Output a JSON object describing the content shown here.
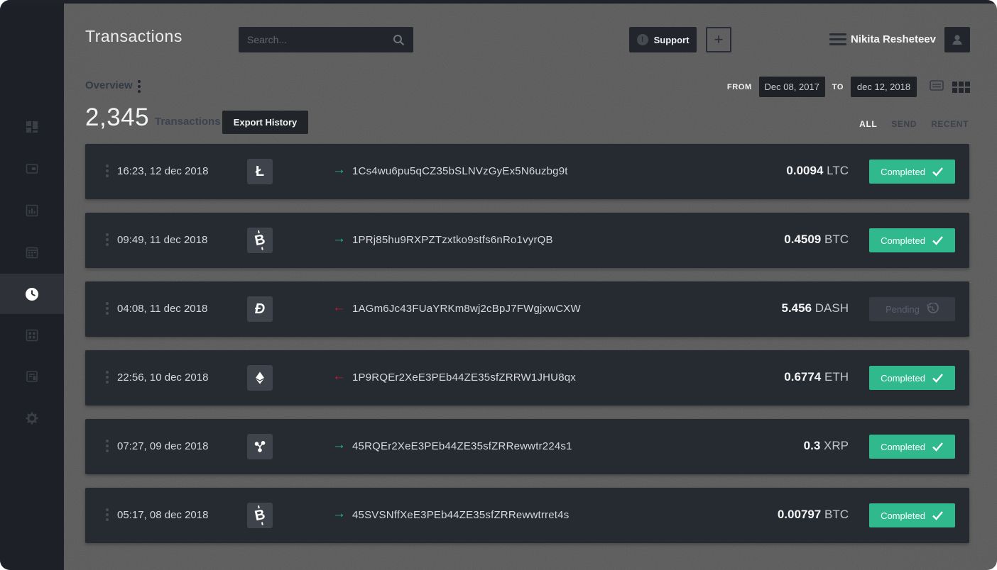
{
  "header": {
    "title": "Transactions",
    "search_placeholder": "Search...",
    "support_label": "Support",
    "support_mark": "!",
    "add_label": "+",
    "user_name": "Nikita Resheteev"
  },
  "toolbar": {
    "section_label": "Overview",
    "count": "2,345",
    "count_label": "Transactions",
    "export_label": "Export History",
    "from_label": "FROM",
    "from_value": "Dec 08, 2017",
    "to_label": "TO",
    "to_value": "dec 12, 2018",
    "filters": [
      {
        "label": "ALL",
        "active": true
      },
      {
        "label": "SEND",
        "active": false
      },
      {
        "label": "RECENT",
        "active": false
      }
    ]
  },
  "icons": {
    "arrow_out": "→",
    "arrow_in": "←",
    "ltc_glyph": "Ł",
    "btc_glyph": "B",
    "dash_glyph": "Đ",
    "sidebar_items": [
      "dashboard",
      "wallet",
      "analytics",
      "calendar",
      "history",
      "table",
      "reports",
      "settings"
    ],
    "active_sidebar_item": "history"
  },
  "colors": {
    "accent_green": "#2fb98d",
    "accent_red": "#be1e2d",
    "row_bg": "#262a31",
    "sidebar_bg": "#1d2026",
    "main_bg": "#595959"
  },
  "transactions": [
    {
      "datetime": "16:23, 12 dec 2018",
      "coin": "LTC",
      "direction": "out",
      "address": "1Cs4wu6pu5qCZ35bSLNVzGyEx5N6uzbg9t",
      "amount": "0.0094",
      "currency": "LTC",
      "status": "Completed"
    },
    {
      "datetime": "09:49, 11 dec 2018",
      "coin": "BTC",
      "direction": "out",
      "address": "1PRj85hu9RXPZTzxtko9stfs6nRo1vyrQB",
      "amount": "0.4509",
      "currency": "BTC",
      "status": "Completed"
    },
    {
      "datetime": "04:08, 11 dec 2018",
      "coin": "DASH",
      "direction": "in",
      "address": "1AGm6Jc43FUaYRKm8wj2cBpJ7FWgjxwCXW",
      "amount": "5.456",
      "currency": "DASH",
      "status": "Pending"
    },
    {
      "datetime": "22:56, 10 dec 2018",
      "coin": "ETH",
      "direction": "in",
      "address": "1P9RQEr2XeE3PEb44ZE35sfZRRW1JHU8qx",
      "amount": "0.6774",
      "currency": "ETH",
      "status": "Completed"
    },
    {
      "datetime": "07:27, 09 dec 2018",
      "coin": "XRP",
      "direction": "out",
      "address": "45RQEr2XeE3PEb44ZE35sfZRRewwtr224s1",
      "amount": "0.3",
      "currency": "XRP",
      "status": "Completed"
    },
    {
      "datetime": "05:17, 08 dec 2018",
      "coin": "BTC",
      "direction": "out",
      "address": "45SVSNffXeE3PEb44ZE35sfZRRewwtrret4s",
      "amount": "0.00797",
      "currency": "BTC",
      "status": "Completed"
    }
  ]
}
